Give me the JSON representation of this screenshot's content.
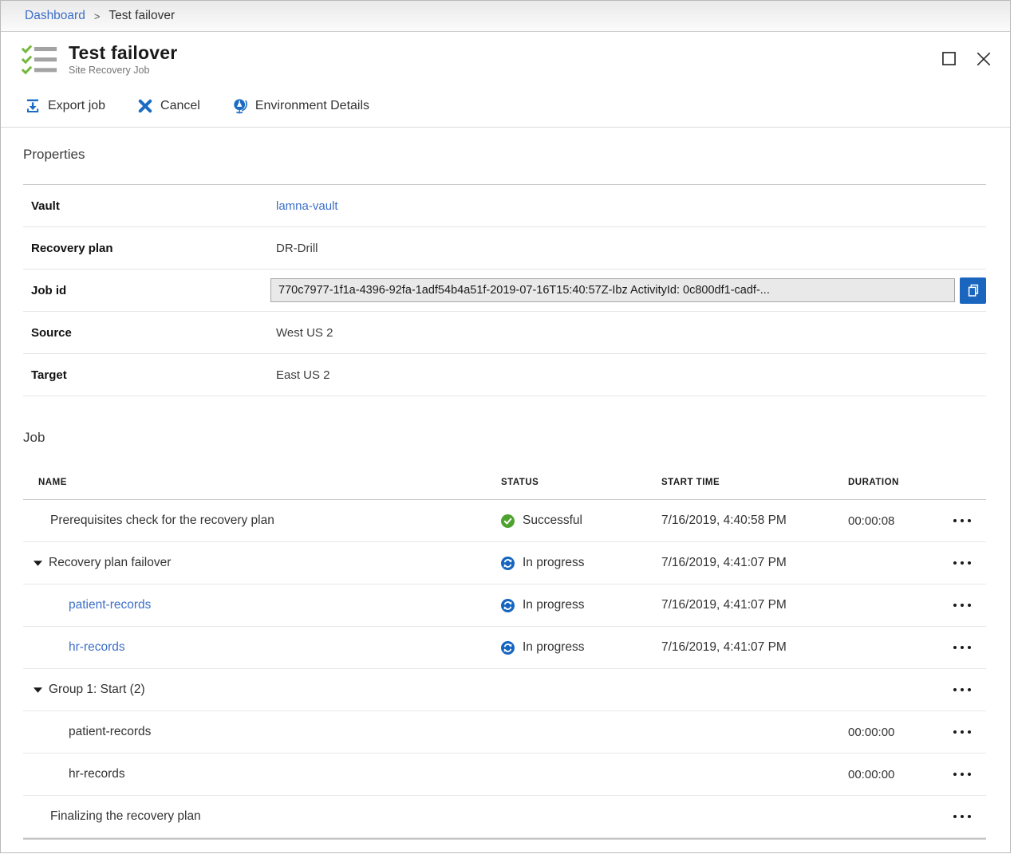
{
  "breadcrumb": {
    "separator": ">",
    "items": [
      {
        "label": "Dashboard",
        "link": true
      },
      {
        "label": "Test failover",
        "link": false
      }
    ]
  },
  "header": {
    "title": "Test failover",
    "subtitle": "Site Recovery Job",
    "icon": "recovery-job-checklist-icon",
    "window_icons": [
      "maximize-icon",
      "close-icon"
    ]
  },
  "toolbar": {
    "items": [
      {
        "id": "export-job",
        "icon": "export-icon",
        "label": "Export job"
      },
      {
        "id": "cancel",
        "icon": "cancel-x-icon",
        "label": "Cancel"
      },
      {
        "id": "environment-details",
        "icon": "globe-icon",
        "label": "Environment Details"
      }
    ]
  },
  "properties": {
    "heading": "Properties",
    "rows": [
      {
        "label": "Vault",
        "value": "lamna-vault",
        "kind": "link"
      },
      {
        "label": "Recovery plan",
        "value": "DR-Drill",
        "kind": "text"
      },
      {
        "label": "Job id",
        "value": "770c7977-1f1a-4396-92fa-1adf54b4a51f-2019-07-16T15:40:57Z-Ibz ActivityId: 0c800df1-cadf-...",
        "kind": "jobid",
        "copy_icon": "copy-icon"
      },
      {
        "label": "Source",
        "value": "West US 2",
        "kind": "text"
      },
      {
        "label": "Target",
        "value": "East US 2",
        "kind": "text"
      }
    ]
  },
  "job": {
    "heading": "Job",
    "columns": [
      "NAME",
      "STATUS",
      "START TIME",
      "DURATION"
    ],
    "rows": [
      {
        "name": "Prerequisites check for the recovery plan",
        "indent": 1,
        "caret": false,
        "link": false,
        "status": {
          "kind": "success",
          "label": "Successful"
        },
        "start_time": "7/16/2019, 4:40:58 PM",
        "duration": "00:00:08"
      },
      {
        "name": "Recovery plan failover",
        "indent": 0,
        "caret": true,
        "link": false,
        "status": {
          "kind": "in-progress",
          "label": "In progress"
        },
        "start_time": "7/16/2019, 4:41:07 PM",
        "duration": ""
      },
      {
        "name": "patient-records",
        "indent": 2,
        "caret": false,
        "link": true,
        "status": {
          "kind": "in-progress",
          "label": "In progress"
        },
        "start_time": "7/16/2019, 4:41:07 PM",
        "duration": ""
      },
      {
        "name": "hr-records",
        "indent": 2,
        "caret": false,
        "link": true,
        "status": {
          "kind": "in-progress",
          "label": "In progress"
        },
        "start_time": "7/16/2019, 4:41:07 PM",
        "duration": ""
      },
      {
        "name": "Group 1: Start (2)",
        "indent": 0,
        "caret": true,
        "link": false,
        "status": null,
        "start_time": "",
        "duration": ""
      },
      {
        "name": "patient-records",
        "indent": 2,
        "caret": false,
        "link": false,
        "status": null,
        "start_time": "",
        "duration": "00:00:00"
      },
      {
        "name": "hr-records",
        "indent": 2,
        "caret": false,
        "link": false,
        "status": null,
        "start_time": "",
        "duration": "00:00:00"
      },
      {
        "name": "Finalizing the recovery plan",
        "indent": 1,
        "caret": false,
        "link": false,
        "status": null,
        "start_time": "",
        "duration": ""
      }
    ]
  },
  "colors": {
    "accent_blue": "#1b6cc2",
    "link_blue": "#3c6ec8",
    "success_green": "#4ea32f",
    "progress_blue": "#1565c0",
    "check_green": "#76b83f"
  }
}
